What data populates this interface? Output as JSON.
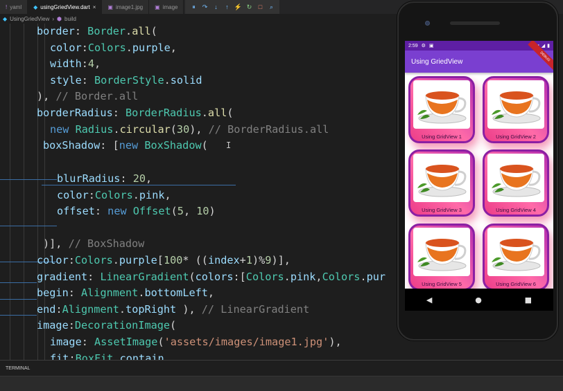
{
  "tabs": [
    {
      "label": "yaml",
      "icon": "yaml-file-icon",
      "active": false
    },
    {
      "label": "usingGriedView.dart",
      "icon": "dart-file-icon",
      "active": true
    },
    {
      "label": "image1.jpg",
      "icon": "image-file-icon",
      "active": false
    },
    {
      "label": "image",
      "icon": "image-file-icon",
      "active": false
    }
  ],
  "debug_toolbar": [
    "pause-icon",
    "step-over-icon",
    "step-into-icon",
    "step-out-icon",
    "hot-reload-icon",
    "restart-icon",
    "stop-icon",
    "inspector-icon"
  ],
  "breadcrumb": {
    "file": "UsingGriedView",
    "item": "build"
  },
  "code": [
    [
      [
        "border",
        "prop"
      ],
      [
        ": ",
        "txt"
      ],
      [
        "Border",
        "cls"
      ],
      [
        ".",
        "txt"
      ],
      [
        "all",
        "fn"
      ],
      [
        "(",
        "txt"
      ]
    ],
    [
      [
        "color",
        "prop"
      ],
      [
        ":",
        "txt"
      ],
      [
        "Colors",
        "cls"
      ],
      [
        ".",
        "txt"
      ],
      [
        "purple",
        "prop"
      ],
      [
        ",",
        "txt"
      ]
    ],
    [
      [
        "width",
        "prop"
      ],
      [
        ":",
        "txt"
      ],
      [
        "4",
        "num"
      ],
      [
        ",",
        "txt"
      ]
    ],
    [
      [
        "style",
        "prop"
      ],
      [
        ": ",
        "txt"
      ],
      [
        "BorderStyle",
        "cls"
      ],
      [
        ".",
        "txt"
      ],
      [
        "solid",
        "prop"
      ]
    ],
    [
      [
        "), ",
        "txt"
      ],
      [
        "// Border.all",
        "cm"
      ]
    ],
    [
      [
        "borderRadius",
        "prop"
      ],
      [
        ": ",
        "txt"
      ],
      [
        "BorderRadius",
        "cls"
      ],
      [
        ".",
        "txt"
      ],
      [
        "all",
        "fn"
      ],
      [
        "(",
        "txt"
      ]
    ],
    [
      [
        "new ",
        "kw"
      ],
      [
        "Radius",
        "cls"
      ],
      [
        ".",
        "txt"
      ],
      [
        "circular",
        "fn"
      ],
      [
        "(",
        "txt"
      ],
      [
        "30",
        "num"
      ],
      [
        "), ",
        "txt"
      ],
      [
        "// BorderRadius.all",
        "cm"
      ]
    ],
    [
      [
        "boxShadow",
        "prop"
      ],
      [
        ": [",
        "txt"
      ],
      [
        "new ",
        "kw"
      ],
      [
        "BoxShadow",
        "cls"
      ],
      [
        "(",
        "txt"
      ]
    ],
    [],
    [
      [
        "blurRadius",
        "prop"
      ],
      [
        ": ",
        "txt"
      ],
      [
        "20",
        "num"
      ],
      [
        ",",
        "txt"
      ]
    ],
    [
      [
        "color",
        "prop"
      ],
      [
        ":",
        "txt"
      ],
      [
        "Colors",
        "cls"
      ],
      [
        ".",
        "txt"
      ],
      [
        "pink",
        "prop"
      ],
      [
        ",",
        "txt"
      ]
    ],
    [
      [
        "offset",
        "prop"
      ],
      [
        ": ",
        "txt"
      ],
      [
        "new ",
        "kw"
      ],
      [
        "Offset",
        "cls"
      ],
      [
        "(",
        "txt"
      ],
      [
        "5",
        "num"
      ],
      [
        ", ",
        "txt"
      ],
      [
        "10",
        "num"
      ],
      [
        ")",
        "txt"
      ]
    ],
    [],
    [
      [
        ")], ",
        "txt"
      ],
      [
        "// BoxShadow",
        "cm"
      ]
    ],
    [
      [
        "color",
        "prop"
      ],
      [
        ":",
        "txt"
      ],
      [
        "Colors",
        "cls"
      ],
      [
        ".",
        "txt"
      ],
      [
        "purple",
        "prop"
      ],
      [
        "[",
        "txt"
      ],
      [
        "100",
        "num"
      ],
      [
        "* ((",
        "txt"
      ],
      [
        "index",
        "prop"
      ],
      [
        "+",
        "txt"
      ],
      [
        "1",
        "num"
      ],
      [
        ")%",
        "txt"
      ],
      [
        "9",
        "num"
      ],
      [
        ")],",
        "txt"
      ]
    ],
    [
      [
        "gradient",
        "prop"
      ],
      [
        ": ",
        "txt"
      ],
      [
        "LinearGradient",
        "cls"
      ],
      [
        "(",
        "txt"
      ],
      [
        "colors",
        "prop"
      ],
      [
        ":[",
        "txt"
      ],
      [
        "Colors",
        "cls"
      ],
      [
        ".",
        "txt"
      ],
      [
        "pink",
        "prop"
      ],
      [
        ",",
        "txt"
      ],
      [
        "Colors",
        "cls"
      ],
      [
        ".",
        "txt"
      ],
      [
        "pur",
        "prop"
      ]
    ],
    [
      [
        "begin",
        "prop"
      ],
      [
        ": ",
        "txt"
      ],
      [
        "Alignment",
        "cls"
      ],
      [
        ".",
        "txt"
      ],
      [
        "bottomLeft",
        "prop"
      ],
      [
        ",",
        "txt"
      ]
    ],
    [
      [
        "end",
        "prop"
      ],
      [
        ":",
        "txt"
      ],
      [
        "Alignment",
        "cls"
      ],
      [
        ".",
        "txt"
      ],
      [
        "topRight",
        "prop"
      ],
      [
        " ), ",
        "txt"
      ],
      [
        "// LinearGradient",
        "cm"
      ]
    ],
    [
      [
        "image",
        "prop"
      ],
      [
        ":",
        "txt"
      ],
      [
        "DecorationImage",
        "cls"
      ],
      [
        "(",
        "txt"
      ]
    ],
    [
      [
        "image",
        "prop"
      ],
      [
        ": ",
        "txt"
      ],
      [
        "AssetImage",
        "cls"
      ],
      [
        "(",
        "txt"
      ],
      [
        "'assets/images/image1.jpg'",
        "str"
      ],
      [
        "),",
        "txt"
      ]
    ],
    [
      [
        "fit",
        "prop"
      ],
      [
        ":",
        "txt"
      ],
      [
        "BoxFit",
        "cls"
      ],
      [
        ".",
        "txt"
      ],
      [
        "contain",
        "prop"
      ]
    ]
  ],
  "terminal_label": "TERMINAL",
  "phone": {
    "status_time": "2:59",
    "app_title": "Using GriedView",
    "debug_banner": "DEBUG",
    "tiles": [
      "Using GridView 1",
      "Using GridView 2",
      "Using GridView 3",
      "Using GridView 4",
      "Using GridView 5",
      "Using GridView 6"
    ],
    "nav": [
      "◀",
      "●",
      "■"
    ]
  }
}
